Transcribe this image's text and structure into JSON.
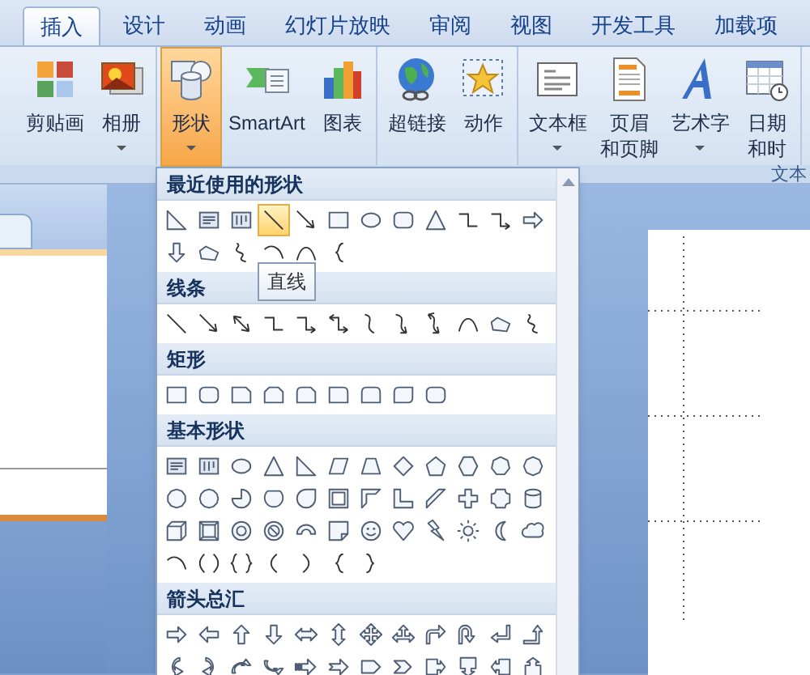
{
  "tabs": [
    {
      "label": "插入",
      "selected": true
    },
    {
      "label": "设计",
      "selected": false
    },
    {
      "label": "动画",
      "selected": false
    },
    {
      "label": "幻灯片放映",
      "selected": false
    },
    {
      "label": "审阅",
      "selected": false
    },
    {
      "label": "视图",
      "selected": false
    },
    {
      "label": "开发工具",
      "selected": false
    },
    {
      "label": "加载项",
      "selected": false
    }
  ],
  "ribbon": {
    "groups": [
      {
        "buttons": [
          {
            "kind": "clip-art",
            "lines": [
              "剪贴画"
            ],
            "dropdown": false,
            "selected": false
          },
          {
            "kind": "photo-album",
            "lines": [
              "相册"
            ],
            "dropdown": true,
            "selected": false
          }
        ]
      },
      {
        "buttons": [
          {
            "kind": "shapes",
            "lines": [
              "形状"
            ],
            "dropdown": true,
            "selected": true
          },
          {
            "kind": "smartart",
            "lines": [
              "SmartArt"
            ],
            "dropdown": false,
            "selected": false
          },
          {
            "kind": "chart",
            "lines": [
              "图表"
            ],
            "dropdown": false,
            "selected": false
          }
        ]
      },
      {
        "buttons": [
          {
            "kind": "globe",
            "lines": [
              "超链接"
            ],
            "dropdown": false,
            "selected": false
          },
          {
            "kind": "action",
            "lines": [
              "动作"
            ],
            "dropdown": false,
            "selected": false
          }
        ]
      },
      {
        "buttons": [
          {
            "kind": "text-box",
            "lines": [
              "文本框"
            ],
            "dropdown": true,
            "selected": false
          },
          {
            "kind": "header-footer",
            "lines": [
              "页眉",
              "和页脚"
            ],
            "dropdown": false,
            "selected": false
          },
          {
            "kind": "wordart",
            "lines": [
              "艺术字"
            ],
            "dropdown": true,
            "selected": false
          },
          {
            "kind": "calendar",
            "lines": [
              "日期",
              "和时"
            ],
            "dropdown": false,
            "selected": false
          }
        ]
      }
    ],
    "group_label": "文本"
  },
  "shapes_menu": {
    "tooltip": "直线",
    "sections": [
      {
        "title": "最近使用的形状",
        "items": [
          {
            "kind": "right-triangle",
            "selected": false
          },
          {
            "kind": "textbox",
            "selected": false
          },
          {
            "kind": "textbox-v",
            "selected": false
          },
          {
            "kind": "line",
            "selected": true
          },
          {
            "kind": "arrow",
            "selected": false
          },
          {
            "kind": "rect",
            "selected": false
          },
          {
            "kind": "oval",
            "selected": false
          },
          {
            "kind": "rounded-rect",
            "selected": false
          },
          {
            "kind": "triangle",
            "selected": false
          },
          {
            "kind": "elbow",
            "selected": false
          },
          {
            "kind": "elbow-arrow",
            "selected": false
          },
          {
            "kind": "block-right",
            "selected": false
          },
          {
            "kind": "block-down",
            "selected": false
          },
          {
            "kind": "freeform",
            "selected": false
          },
          {
            "kind": "scribble",
            "selected": false
          },
          {
            "kind": "arc",
            "selected": false
          },
          {
            "kind": "freeform-curve",
            "selected": false
          },
          {
            "kind": "left-brace",
            "selected": false
          }
        ]
      },
      {
        "title": "线条",
        "items": [
          {
            "kind": "line",
            "selected": false
          },
          {
            "kind": "arrow",
            "selected": false
          },
          {
            "kind": "double-arrow",
            "selected": false
          },
          {
            "kind": "elbow",
            "selected": false
          },
          {
            "kind": "elbow-arrow",
            "selected": false
          },
          {
            "kind": "elbow-double",
            "selected": false
          },
          {
            "kind": "curve",
            "selected": false
          },
          {
            "kind": "curve-arrow",
            "selected": false
          },
          {
            "kind": "curve-double",
            "selected": false
          },
          {
            "kind": "freeform-curve",
            "selected": false
          },
          {
            "kind": "freeform",
            "selected": false
          },
          {
            "kind": "scribble",
            "selected": false
          }
        ]
      },
      {
        "title": "矩形",
        "items": [
          {
            "kind": "rect",
            "selected": false
          },
          {
            "kind": "rounded-rect",
            "selected": false
          },
          {
            "kind": "snip-rect",
            "selected": false
          },
          {
            "kind": "snip2-rect",
            "selected": false
          },
          {
            "kind": "snip-round",
            "selected": false
          },
          {
            "kind": "round1-rect",
            "selected": false
          },
          {
            "kind": "round2-rect",
            "selected": false
          },
          {
            "kind": "round-diag",
            "selected": false
          },
          {
            "kind": "rounded-rect",
            "selected": false
          }
        ]
      },
      {
        "title": "基本形状",
        "items": [
          {
            "kind": "textbox",
            "selected": false
          },
          {
            "kind": "textbox-v",
            "selected": false
          },
          {
            "kind": "oval",
            "selected": false
          },
          {
            "kind": "triangle",
            "selected": false
          },
          {
            "kind": "right-triangle",
            "selected": false
          },
          {
            "kind": "parallelogram",
            "selected": false
          },
          {
            "kind": "trapezoid",
            "selected": false
          },
          {
            "kind": "diamond",
            "selected": false
          },
          {
            "kind": "pentagon",
            "selected": false
          },
          {
            "kind": "hexagon",
            "selected": false
          },
          {
            "kind": "heptagon",
            "selected": false
          },
          {
            "kind": "octagon",
            "selected": false
          },
          {
            "kind": "decagon",
            "selected": false
          },
          {
            "kind": "dodecagon",
            "selected": false
          },
          {
            "kind": "pie",
            "selected": false
          },
          {
            "kind": "chord",
            "selected": false
          },
          {
            "kind": "teardrop",
            "selected": false
          },
          {
            "kind": "frame",
            "selected": false
          },
          {
            "kind": "half-frame",
            "selected": false
          },
          {
            "kind": "l-shape",
            "selected": false
          },
          {
            "kind": "diagonal-stripe",
            "selected": false
          },
          {
            "kind": "plus",
            "selected": false
          },
          {
            "kind": "plaque",
            "selected": false
          },
          {
            "kind": "cylinder",
            "selected": false
          },
          {
            "kind": "cube",
            "selected": false
          },
          {
            "kind": "bevel",
            "selected": false
          },
          {
            "kind": "donut",
            "selected": false
          },
          {
            "kind": "no-symbol",
            "selected": false
          },
          {
            "kind": "block-arc",
            "selected": false
          },
          {
            "kind": "folded-corner",
            "selected": false
          },
          {
            "kind": "smiley",
            "selected": false
          },
          {
            "kind": "heart",
            "selected": false
          },
          {
            "kind": "lightning",
            "selected": false
          },
          {
            "kind": "sun",
            "selected": false
          },
          {
            "kind": "moon",
            "selected": false
          },
          {
            "kind": "cloud",
            "selected": false
          },
          {
            "kind": "arc",
            "selected": false
          },
          {
            "kind": "bracket-pair",
            "selected": false
          },
          {
            "kind": "brace-pair",
            "selected": false
          },
          {
            "kind": "left-bracket",
            "selected": false
          },
          {
            "kind": "right-bracket",
            "selected": false
          },
          {
            "kind": "left-brace",
            "selected": false
          },
          {
            "kind": "right-brace",
            "selected": false
          }
        ]
      },
      {
        "title": "箭头总汇",
        "items": [
          {
            "kind": "block-right",
            "selected": false
          },
          {
            "kind": "block-left",
            "selected": false
          },
          {
            "kind": "block-up",
            "selected": false
          },
          {
            "kind": "block-down",
            "selected": false
          },
          {
            "kind": "left-right",
            "selected": false
          },
          {
            "kind": "up-down",
            "selected": false
          },
          {
            "kind": "quad",
            "selected": false
          },
          {
            "kind": "left-right-up",
            "selected": false
          },
          {
            "kind": "bent",
            "selected": false
          },
          {
            "kind": "u-turn",
            "selected": false
          },
          {
            "kind": "left-up",
            "selected": false
          },
          {
            "kind": "bent-up",
            "selected": false
          },
          {
            "kind": "curved-right",
            "selected": false
          },
          {
            "kind": "curved-left",
            "selected": false
          },
          {
            "kind": "curved-up",
            "selected": false
          },
          {
            "kind": "curved-down",
            "selected": false
          },
          {
            "kind": "striped-right",
            "selected": false
          },
          {
            "kind": "notched-right",
            "selected": false
          },
          {
            "kind": "pentagon-arrow",
            "selected": false
          },
          {
            "kind": "chevron",
            "selected": false
          },
          {
            "kind": "right-callout",
            "selected": false
          },
          {
            "kind": "down-callout",
            "selected": false
          },
          {
            "kind": "left-callout",
            "selected": false
          },
          {
            "kind": "up-callout",
            "selected": false
          }
        ]
      }
    ]
  }
}
